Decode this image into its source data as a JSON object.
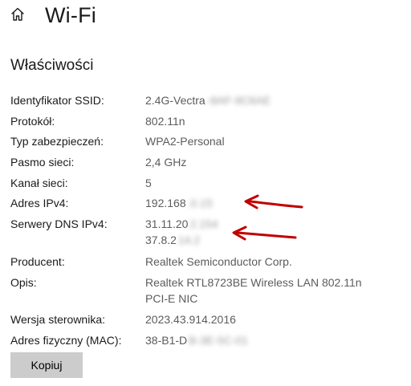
{
  "header": {
    "title": "Wi-Fi",
    "home_icon": "home-icon"
  },
  "section": {
    "title": "Właściwości"
  },
  "properties": [
    {
      "label": "Identyfikator SSID:",
      "value": "2.4G-Vectra",
      "hidden": "-8AF-9C6AE"
    },
    {
      "label": "Protokół:",
      "value": "802.11n"
    },
    {
      "label": "Typ zabezpieczeń:",
      "value": "WPA2-Personal"
    },
    {
      "label": "Pasmo sieci:",
      "value": "2,4 GHz"
    },
    {
      "label": "Kanał sieci:",
      "value": "5"
    },
    {
      "label": "Adres IPv4:",
      "value": "192.168",
      "hidden": ".0.15"
    },
    {
      "label": "Serwery DNS IPv4:",
      "value": "31.11.20",
      "hidden": "2.154",
      "value2": "37.8.2",
      "hidden2": "14.2"
    },
    {
      "label": "Producent:",
      "value": "Realtek Semiconductor Corp."
    },
    {
      "label": "Opis:",
      "value": "Realtek RTL8723BE Wireless LAN 802.11n",
      "value2": "PCI-E NIC"
    },
    {
      "label": "Wersja sterownika:",
      "value": "2023.43.914.2016"
    },
    {
      "label": "Adres fizyczny (MAC):",
      "value": "38-B1-D",
      "hidden": "B-3E-5C-01"
    }
  ],
  "actions": {
    "copy_label": "Kopiuj"
  },
  "annotations": {
    "arrow_color": "#c00000"
  }
}
